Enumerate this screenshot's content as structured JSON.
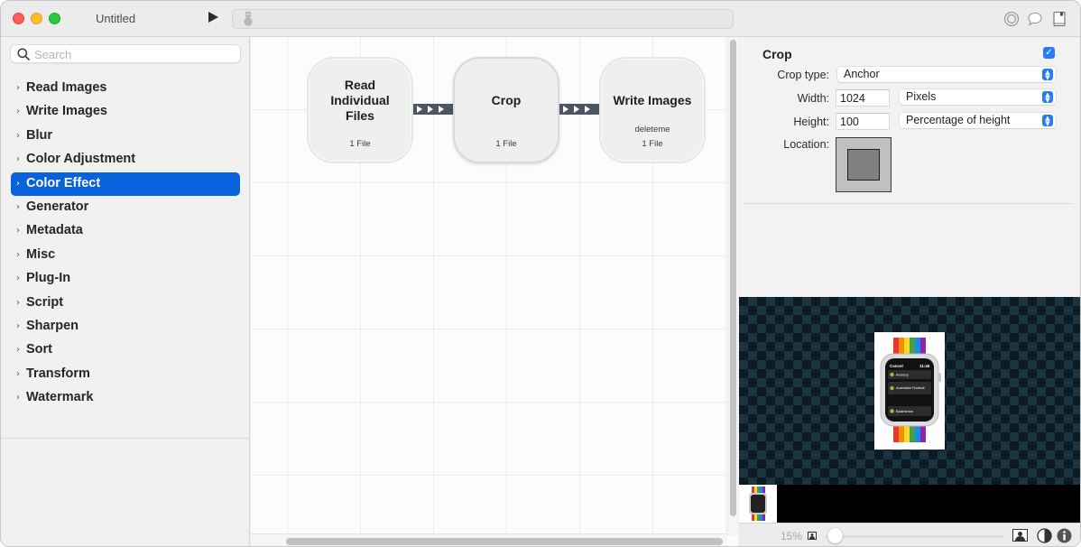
{
  "window": {
    "title": "Untitled"
  },
  "toolbar": {
    "run_icon": "play-icon",
    "toolbox_icon": "robot-icon",
    "right_icons": [
      "target-icon",
      "speech-bubble-icon",
      "book-icon"
    ]
  },
  "sidebar": {
    "search_placeholder": "Search",
    "items": [
      {
        "label": "Read Images",
        "selected": false
      },
      {
        "label": "Write Images",
        "selected": false
      },
      {
        "label": "Blur",
        "selected": false
      },
      {
        "label": "Color Adjustment",
        "selected": false
      },
      {
        "label": "Color Effect",
        "selected": true
      },
      {
        "label": "Generator",
        "selected": false
      },
      {
        "label": "Metadata",
        "selected": false
      },
      {
        "label": "Misc",
        "selected": false
      },
      {
        "label": "Plug-In",
        "selected": false
      },
      {
        "label": "Script",
        "selected": false
      },
      {
        "label": "Sharpen",
        "selected": false
      },
      {
        "label": "Sort",
        "selected": false
      },
      {
        "label": "Transform",
        "selected": false
      },
      {
        "label": "Watermark",
        "selected": false
      }
    ],
    "chevron": "›",
    "selected_color": "#0862dc"
  },
  "workflow": {
    "nodes": [
      {
        "title_lines": [
          "Read",
          "Individual",
          "Files"
        ],
        "subtitle": "",
        "count": "1 File"
      },
      {
        "title_lines": [
          "Crop"
        ],
        "subtitle": "",
        "count": "1 File"
      },
      {
        "title_lines": [
          "Write Images"
        ],
        "subtitle": "deleteme",
        "count": "1 File"
      }
    ]
  },
  "inspector": {
    "title": "Crop",
    "enabled": true,
    "check_glyph": "✓",
    "crop_type_label": "Crop type:",
    "crop_type_value": "Anchor",
    "width_label": "Width:",
    "width_value": "1024",
    "width_unit": "Pixels",
    "height_label": "Height:",
    "height_value": "100",
    "height_unit": "Percentage of height",
    "location_label": "Location:"
  },
  "preview": {
    "watch_screen": {
      "header_left": "Cancel",
      "header_right": "11:46",
      "rows": [
        "Archery",
        "Australian Football",
        "Badminton"
      ]
    }
  },
  "bottombar": {
    "zoom_level": "15%",
    "zoom_fraction": 0.0
  },
  "colors": {
    "accent": "#2a7cf6",
    "connector": "#4c5563"
  }
}
